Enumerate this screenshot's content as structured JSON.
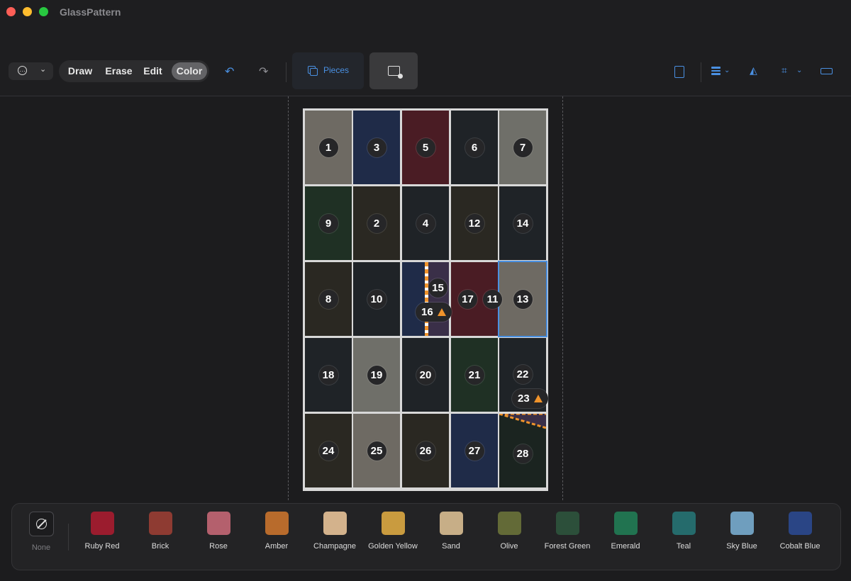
{
  "app": {
    "title": "GlassPattern"
  },
  "toolbar": {
    "modes": [
      "Draw",
      "Erase",
      "Edit",
      "Color"
    ],
    "active_mode": "Color",
    "pieces_label": "Pieces"
  },
  "board": {
    "cells": [
      {
        "label": "1",
        "color": "#6e6a63"
      },
      {
        "label": "3",
        "color": "#1f2b48"
      },
      {
        "label": "5",
        "color": "#4a1c24"
      },
      {
        "label": "6",
        "color": "#1f2327"
      },
      {
        "label": "7",
        "color": "#6f6f69"
      },
      {
        "label": "9",
        "color": "#1f3024"
      },
      {
        "label": "2",
        "color": "#2a2822"
      },
      {
        "label": "4",
        "color": "#1f2327"
      },
      {
        "label": "12",
        "color": "#2a2822"
      },
      {
        "label": "14",
        "color": "#1f2327"
      },
      {
        "label": "8",
        "color": "#2a2822"
      },
      {
        "label": "10",
        "color": "#1f2327"
      },
      {
        "label": "",
        "color": "#1f2b48"
      },
      {
        "label": "17",
        "color": "#4a1c24"
      },
      {
        "label": "13",
        "color": "#6e6a63"
      },
      {
        "label": "18",
        "color": "#1f2327"
      },
      {
        "label": "19",
        "color": "#6f6f69"
      },
      {
        "label": "20",
        "color": "#1f2327"
      },
      {
        "label": "21",
        "color": "#1f3024"
      },
      {
        "label": "22",
        "color": "#1f2327"
      },
      {
        "label": "24",
        "color": "#2a2822"
      },
      {
        "label": "25",
        "color": "#6e6a63"
      },
      {
        "label": "26",
        "color": "#2a2822"
      },
      {
        "label": "27",
        "color": "#1f2b48"
      },
      {
        "label": "28",
        "color": "#1b2420"
      }
    ],
    "extra_pieces": [
      "15",
      "16",
      "11",
      "23"
    ],
    "selected": "13"
  },
  "palette": {
    "none_label": "None",
    "colors": [
      {
        "name": "Ruby Red",
        "hex": "#9b1c2e"
      },
      {
        "name": "Brick",
        "hex": "#8e3b32"
      },
      {
        "name": "Rose",
        "hex": "#b4606d"
      },
      {
        "name": "Amber",
        "hex": "#b86b2c"
      },
      {
        "name": "Champagne",
        "hex": "#d3b28c"
      },
      {
        "name": "Golden Yellow",
        "hex": "#c99b3f"
      },
      {
        "name": "Sand",
        "hex": "#c7ae87"
      },
      {
        "name": "Olive",
        "hex": "#636a37"
      },
      {
        "name": "Forest Green",
        "hex": "#2c4f3a"
      },
      {
        "name": "Emerald",
        "hex": "#217350"
      },
      {
        "name": "Teal",
        "hex": "#256b6c"
      },
      {
        "name": "Sky Blue",
        "hex": "#6f9ebe"
      },
      {
        "name": "Cobalt Blue",
        "hex": "#2a4585"
      }
    ]
  }
}
